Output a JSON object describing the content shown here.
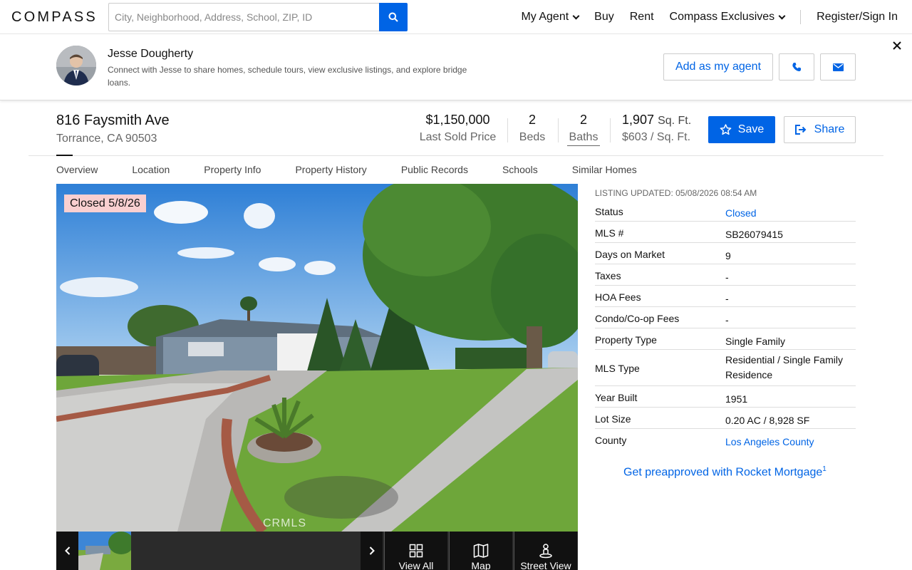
{
  "nav": {
    "logo": "COMPASS",
    "search_placeholder": "City, Neighborhood, Address, School, ZIP, ID",
    "links": [
      "My Agent",
      "Buy",
      "Rent",
      "Compass Exclusives"
    ],
    "signin": "Register/Sign In"
  },
  "agent": {
    "name": "Jesse Dougherty",
    "description": "Connect with Jesse to share homes, schedule tours, view exclusive listings, and explore bridge loans.",
    "add_label": "Add as my agent"
  },
  "property": {
    "address": "816 Faysmith Ave",
    "city": "Torrance, CA 90503",
    "price": "$1,150,000",
    "price_label": "Last Sold Price",
    "beds": "2",
    "beds_label": "Beds",
    "baths": "2",
    "baths_label": "Baths",
    "sqft": "1,907",
    "sqft_unit": "Sq. Ft.",
    "price_per_sqft": "$603 / Sq. Ft.",
    "save_label": "Save",
    "share_label": "Share"
  },
  "tabs": [
    "Overview",
    "Location",
    "Property Info",
    "Property History",
    "Public Records",
    "Schools",
    "Similar Homes"
  ],
  "photo": {
    "badge": "Closed 5/8/26",
    "watermark": "CRMLS"
  },
  "gallery_actions": [
    "View All",
    "Map",
    "Street View"
  ],
  "listing": {
    "updated": "LISTING UPDATED: 05/08/2026 08:54 AM",
    "rows": [
      {
        "k": "Status",
        "v": "Closed"
      },
      {
        "k": "MLS #",
        "v": "SB26079415"
      },
      {
        "k": "Days on Market",
        "v": "9"
      },
      {
        "k": "Taxes",
        "v": "-"
      },
      {
        "k": "HOA Fees",
        "v": "-"
      },
      {
        "k": "Condo/Co-op Fees",
        "v": "-"
      },
      {
        "k": "Property Type",
        "v": "Single Family"
      },
      {
        "k": "MLS Type",
        "v": "Residential / Single Family Residence"
      },
      {
        "k": "Year Built",
        "v": "1951"
      },
      {
        "k": "Lot Size",
        "v": "0.20 AC / 8,928 SF"
      },
      {
        "k": "County",
        "v": "Los Angeles County"
      }
    ],
    "preapproved": "Get preapproved with Rocket Mortgage",
    "preapproved_sup": "1"
  },
  "colors": {
    "brand_blue": "#0064e5",
    "badge_pink": "#f9cfd0"
  }
}
